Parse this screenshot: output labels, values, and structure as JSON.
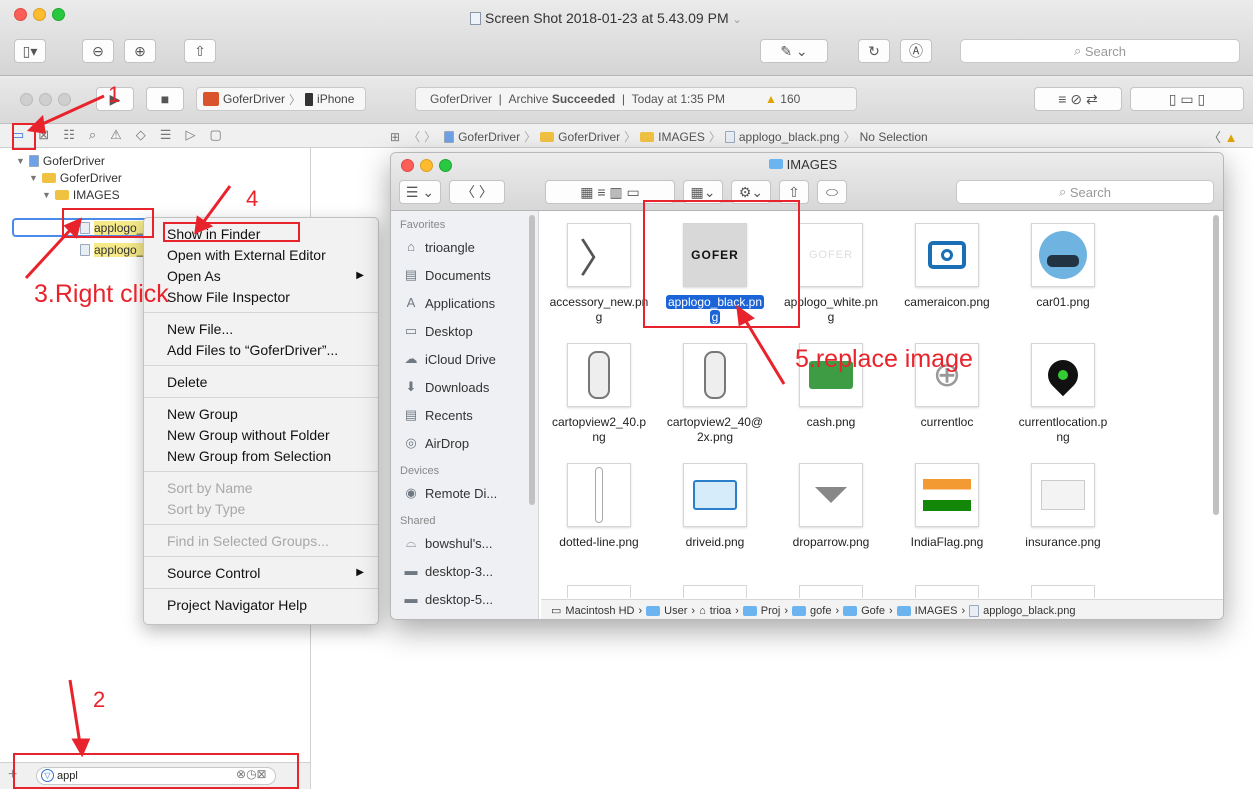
{
  "preview": {
    "title": "Screen Shot 2018-01-23 at 5.43.09 PM",
    "search_placeholder": "Search"
  },
  "xcode": {
    "scheme": "GoferDriver",
    "device": "iPhone",
    "activity": {
      "project": "GoferDriver",
      "status_prefix": "Archive",
      "status_bold": "Succeeded",
      "time": "Today at 1:35 PM",
      "warnings": "160"
    },
    "jumpbar": [
      "GoferDriver",
      "GoferDriver",
      "IMAGES",
      "applogo_black.png",
      "No Selection"
    ],
    "tree": {
      "project": "GoferDriver",
      "group": "GoferDriver",
      "folder": "IMAGES",
      "file1": "applogo_",
      "file2": "applogo_"
    },
    "filter_value": "appl"
  },
  "context_menu": {
    "groups": [
      [
        "Show in Finder",
        "Open with External Editor",
        "Open As",
        "Show File Inspector"
      ],
      [
        "New File...",
        "Add Files to “GoferDriver”..."
      ],
      [
        "Delete"
      ],
      [
        "New Group",
        "New Group without Folder",
        "New Group from Selection"
      ],
      [
        "Sort by Name",
        "Sort by Type"
      ],
      [
        "Find in Selected Groups..."
      ],
      [
        "Source Control"
      ],
      [
        "Project Navigator Help"
      ]
    ]
  },
  "finder": {
    "title": "IMAGES",
    "search_placeholder": "Search",
    "sidebar": {
      "favorites_label": "Favorites",
      "favorites": [
        "trioangle",
        "Documents",
        "Applications",
        "Desktop",
        "iCloud Drive",
        "Downloads",
        "Recents",
        "AirDrop"
      ],
      "devices_label": "Devices",
      "devices": [
        "Remote Di..."
      ],
      "shared_label": "Shared",
      "shared": [
        "bowshul's...",
        "desktop-3...",
        "desktop-5..."
      ]
    },
    "files": [
      {
        "name1": "accessory_new.pn",
        "name2": "g"
      },
      {
        "name1": "applogo_black.pn",
        "name2": "g"
      },
      {
        "name1": "applogo_white.pn",
        "name2": "g"
      },
      {
        "name1": "cameraicon.png",
        "name2": ""
      },
      {
        "name1": "car01.png",
        "name2": ""
      },
      {
        "name1": "cartopview2_40.p",
        "name2": "ng"
      },
      {
        "name1": "cartopview2_40@",
        "name2": "2x.png"
      },
      {
        "name1": "cash.png",
        "name2": ""
      },
      {
        "name1": "currentloc",
        "name2": ""
      },
      {
        "name1": "currentlocation.p",
        "name2": "ng"
      },
      {
        "name1": "dotted-line.png",
        "name2": ""
      },
      {
        "name1": "driveid.png",
        "name2": ""
      },
      {
        "name1": "droparrow.png",
        "name2": ""
      },
      {
        "name1": "IndiaFlag.png",
        "name2": ""
      },
      {
        "name1": "insurance.png",
        "name2": ""
      }
    ],
    "logo_text": "GOFER",
    "path": [
      "Macintosh HD",
      "User",
      "trioa",
      "Proj",
      "gofe",
      "Gofe",
      "IMAGES",
      "applogo_black.png"
    ]
  },
  "annotations": {
    "step1": "1",
    "step2": "2",
    "step3": "3.Right click",
    "step4": "4",
    "step5": "5.replace image"
  },
  "colors": {
    "annotation": "#e8232b",
    "selection": "#1b64d8",
    "folder": "#f1c241"
  }
}
